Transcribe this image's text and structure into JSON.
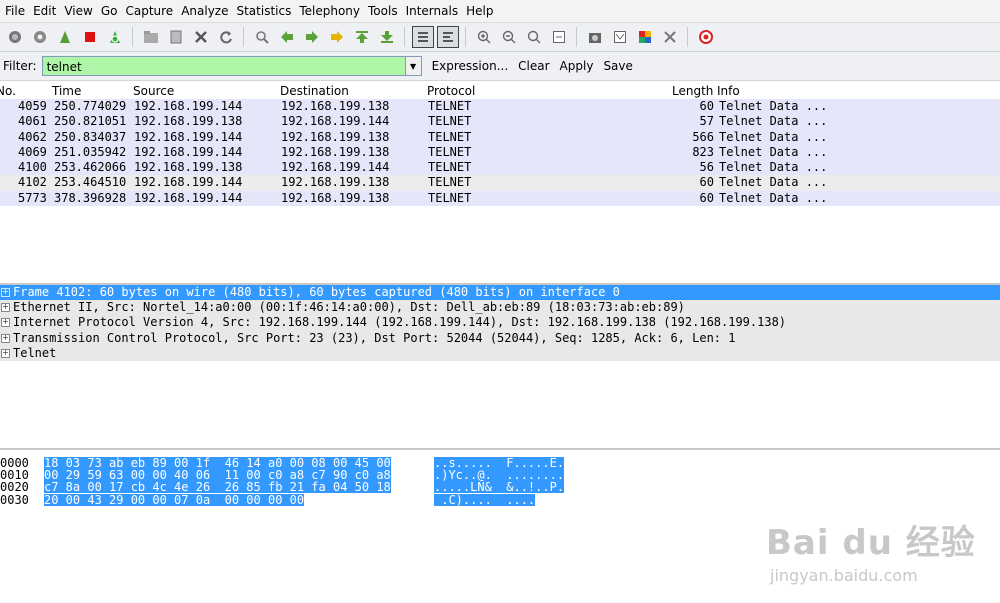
{
  "menubar": [
    "File",
    "Edit",
    "View",
    "Go",
    "Capture",
    "Analyze",
    "Statistics",
    "Telephony",
    "Tools",
    "Internals",
    "Help"
  ],
  "toolbar_icons": [
    "interfaces-icon",
    "options-icon",
    "start-capture-icon",
    "stop-capture-icon",
    "restart-capture-icon",
    "open-file-icon",
    "save-file-icon",
    "close-file-icon",
    "reload-icon",
    "find-icon",
    "go-back-icon",
    "go-forward-icon",
    "go-to-packet-icon",
    "first-packet-icon",
    "last-packet-icon",
    "colorize-icon",
    "autoscroll-icon",
    "zoom-in-icon",
    "zoom-out-icon",
    "normal-size-icon",
    "resize-columns-icon",
    "capture-filters-icon",
    "display-filters-icon",
    "coloring-rules-icon",
    "preferences-icon",
    "help-icon"
  ],
  "filter": {
    "label": "Filter:",
    "value": "telnet",
    "expression": "Expression...",
    "clear": "Clear",
    "apply": "Apply",
    "save": "Save"
  },
  "packet_list": {
    "columns": [
      "No.",
      "Time",
      "Source",
      "Destination",
      "Protocol",
      "Length",
      "Info"
    ],
    "rows": [
      {
        "no": "4059",
        "time": "250.774029",
        "src": "192.168.199.144",
        "dst": "192.168.199.138",
        "proto": "TELNET",
        "len": "60",
        "info": "Telnet Data ..."
      },
      {
        "no": "4061",
        "time": "250.821051",
        "src": "192.168.199.138",
        "dst": "192.168.199.144",
        "proto": "TELNET",
        "len": "57",
        "info": "Telnet Data ..."
      },
      {
        "no": "4062",
        "time": "250.834037",
        "src": "192.168.199.144",
        "dst": "192.168.199.138",
        "proto": "TELNET",
        "len": "566",
        "info": "Telnet Data ..."
      },
      {
        "no": "4069",
        "time": "251.035942",
        "src": "192.168.199.144",
        "dst": "192.168.199.138",
        "proto": "TELNET",
        "len": "823",
        "info": "Telnet Data ..."
      },
      {
        "no": "4100",
        "time": "253.462066",
        "src": "192.168.199.138",
        "dst": "192.168.199.144",
        "proto": "TELNET",
        "len": "56",
        "info": "Telnet Data ..."
      },
      {
        "no": "4102",
        "time": "253.464510",
        "src": "192.168.199.144",
        "dst": "192.168.199.138",
        "proto": "TELNET",
        "len": "60",
        "info": "Telnet Data ..."
      },
      {
        "no": "5773",
        "time": "378.396928",
        "src": "192.168.199.144",
        "dst": "192.168.199.138",
        "proto": "TELNET",
        "len": "60",
        "info": "Telnet Data ..."
      }
    ]
  },
  "details": [
    "Frame 4102: 60 bytes on wire (480 bits), 60 bytes captured (480 bits) on interface 0",
    "Ethernet II, Src: Nortel_14:a0:00 (00:1f:46:14:a0:00), Dst: Dell_ab:eb:89 (18:03:73:ab:eb:89)",
    "Internet Protocol Version 4, Src: 192.168.199.144 (192.168.199.144), Dst: 192.168.199.138 (192.168.199.138)",
    "Transmission Control Protocol, Src Port: 23 (23), Dst Port: 52044 (52044), Seq: 1285, Ack: 6, Len: 1",
    "Telnet"
  ],
  "bytes": [
    {
      "offset": "0000",
      "hex": "18 03 73 ab eb 89 00 1f  46 14 a0 00 08 00 45 00",
      "ascii": "..s.....  F.....E."
    },
    {
      "offset": "0010",
      "hex": "00 29 59 63 00 00 40 06  11 00 c0 a8 c7 90 c0 a8",
      "ascii": ".)Yc..@.  ........"
    },
    {
      "offset": "0020",
      "hex": "c7 8a 00 17 cb 4c 4e 26  26 85 fb 21 fa 04 50 18",
      "ascii": ".....LN&  &..!..P."
    },
    {
      "offset": "0030",
      "hex": "20 00 43 29 00 00 07 0a  00 00 00 00",
      "ascii": " .C)....  ...."
    }
  ],
  "watermark": {
    "logo": "Bai du 经验",
    "url": "jingyan.baidu.com"
  },
  "colors": {
    "row_bg": "#e6e6fa",
    "selection": "#3399ff",
    "filter_ok": "#aff5a8"
  }
}
